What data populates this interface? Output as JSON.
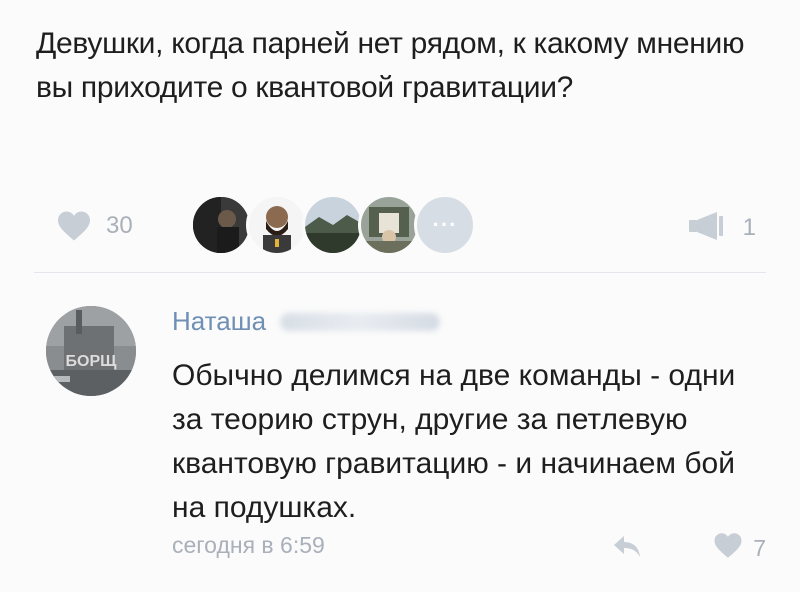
{
  "post": {
    "text": "Девушки, когда парней нет рядом, к какому мнению вы приходите о квантовой гравитации?",
    "likes_count": "30",
    "more_likers": "···",
    "reposts_count": "1"
  },
  "comment": {
    "author": "Наташа",
    "avatar_text": "БОРЩ",
    "text": "Обычно делимся на две команды - одни за теорию струн, другие за петлевую квантовую гравитацию - и начинаем бой на подушках.",
    "date": "сегодня в 6:59",
    "likes_count": "7"
  },
  "colors": {
    "text": "#1e1e1e",
    "muted": "#a9b0ba",
    "link": "#6f8fb4",
    "background": "#fbfbfb"
  },
  "icons": [
    "heart-icon",
    "megaphone-icon",
    "reply-arrow-icon",
    "ellipsis-icon"
  ]
}
